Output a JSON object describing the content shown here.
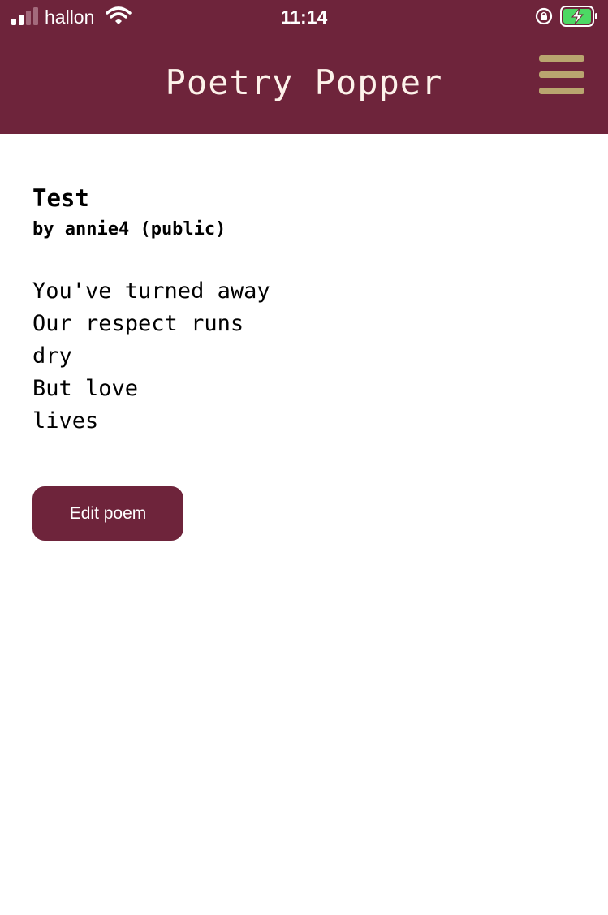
{
  "status_bar": {
    "carrier": "hallon",
    "time": "11:14",
    "icons": [
      "cellular-signal-icon",
      "wifi-icon",
      "rotation-lock-icon",
      "battery-charging-icon"
    ]
  },
  "header": {
    "title": "Poetry Popper",
    "menu_icon": "hamburger-menu-icon"
  },
  "poem": {
    "title": "Test",
    "author_line": "by annie4 (public)",
    "lines": [
      "You've turned away",
      "Our respect runs",
      "dry",
      "But love",
      "lives"
    ]
  },
  "actions": {
    "edit_label": "Edit poem"
  },
  "colors": {
    "brand": "#6e243b",
    "menu_accent": "#b9a56f",
    "title_text": "#fdf2ea",
    "battery_green": "#4cd964"
  }
}
